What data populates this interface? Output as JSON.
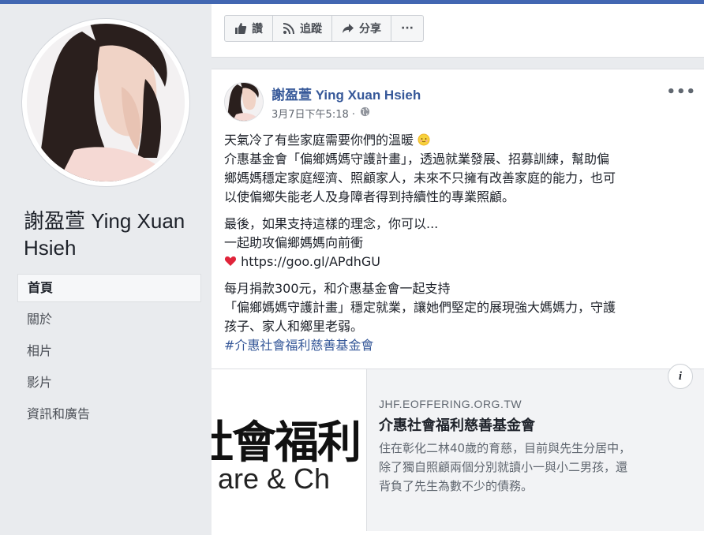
{
  "page": {
    "name": "謝盈萱 Ying Xuan Hsieh"
  },
  "nav": {
    "items": [
      {
        "label": "首頁",
        "active": true
      },
      {
        "label": "關於",
        "active": false
      },
      {
        "label": "相片",
        "active": false
      },
      {
        "label": "影片",
        "active": false
      },
      {
        "label": "資訊和廣告",
        "active": false
      }
    ]
  },
  "actions": {
    "like_label": "讚",
    "follow_label": "追蹤",
    "share_label": "分享",
    "more_label": "···"
  },
  "post": {
    "author": "謝盈萱 Ying Xuan Hsieh",
    "time": "3月7日下午5:18 ·",
    "more_label": "•••",
    "lines": {
      "l1": "天氣冷了有些家庭需要你們的溫暖",
      "l2": "介惠基金會「偏鄉媽媽守護計畫」，透過就業發展、招募訓練，幫助偏",
      "l3": "鄉媽媽穩定家庭經濟、照顧家人，未來不只擁有改善家庭的能力，也可",
      "l4": "以使偏鄉失能老人及身障者得到持續性的專業照顧。",
      "l5": "最後，如果支持這樣的理念，你可以...",
      "l6": "一起助攻偏鄉媽媽向前衝",
      "l7_link": "https://goo.gl/APdhGU",
      "l8": "每月捐款300元，和介惠基金會一起支持",
      "l9": "「偏鄉媽媽守護計畫」穩定就業，讓她們堅定的展現強大媽媽力，守護",
      "l10": "孩子、家人和鄉里老弱。",
      "hashtag": "#介惠社會福利慈善基金會"
    },
    "emoji_icons": [
      "sun-emoji",
      "heart-emoji"
    ]
  },
  "link_card": {
    "image_text_main": "社會福利",
    "image_text_sub": "are & Ch",
    "domain": "JHF.EOFFERING.ORG.TW",
    "title": "介惠社會福利慈善基金會",
    "desc_lines": [
      "住在彰化二林40歲的育慈，目前與先生分居中，",
      "除了獨自照顧兩個分別就讀小一與小二男孩，還",
      "背負了先生為數不少的債務。"
    ],
    "info_label": "i"
  },
  "colors": {
    "brand": "#4267b2",
    "link": "#365899",
    "background": "#e9ebee"
  }
}
